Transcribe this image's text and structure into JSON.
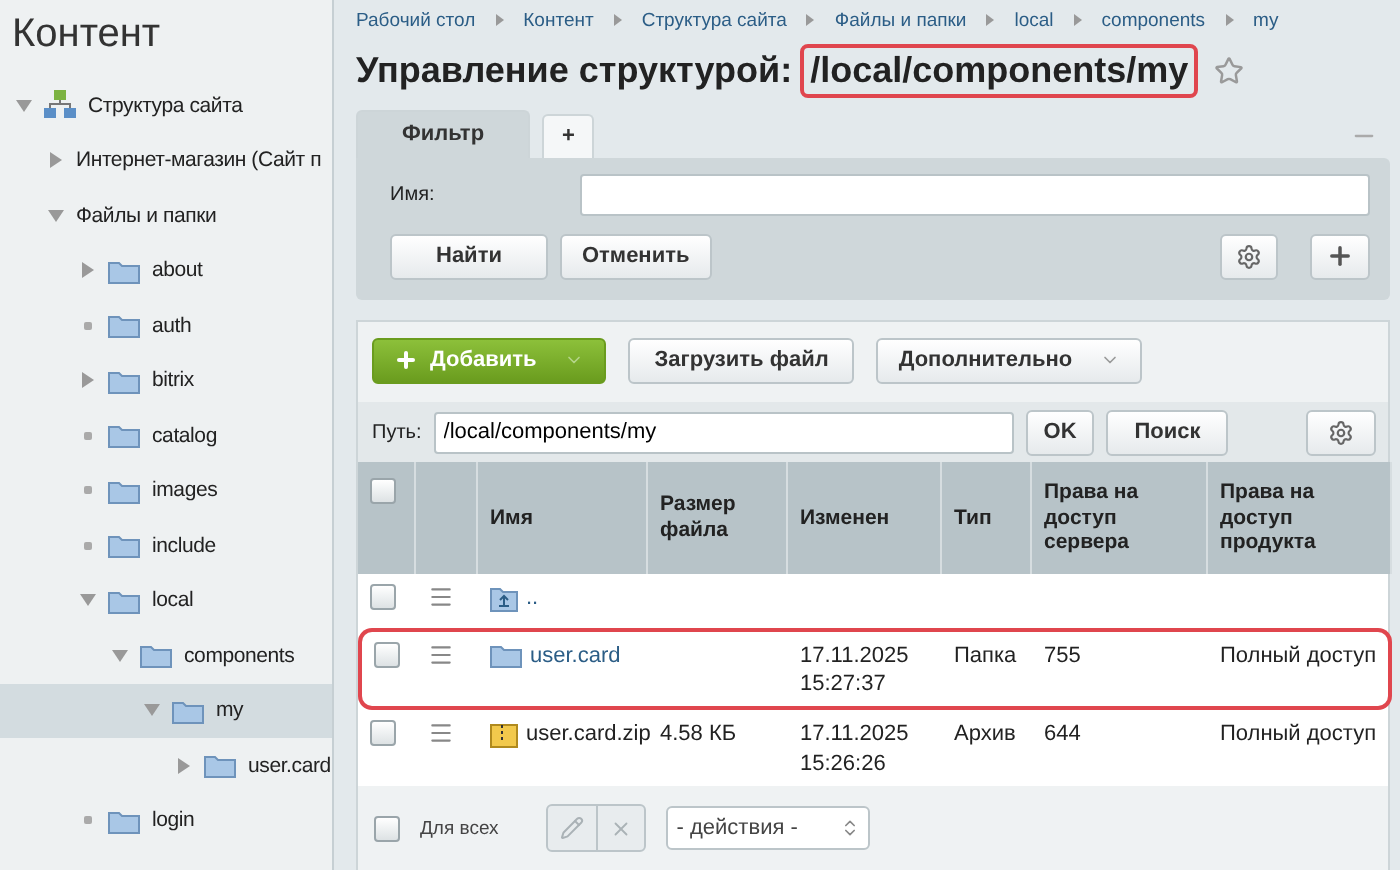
{
  "sidebar": {
    "title": "Контент",
    "tree": [
      {
        "label": "Структура сайта",
        "kind": "site",
        "expanded": true,
        "selected": false,
        "children": [
          {
            "label": "Интернет-магазин (Сайт п",
            "expanded": false,
            "selected": false
          },
          {
            "label": "Файлы и папки",
            "expanded": true,
            "selected": false,
            "children": [
              {
                "label": "about",
                "kind": "folder",
                "expanded": false,
                "selected": false
              },
              {
                "label": "auth",
                "kind": "folder",
                "leaf": true,
                "selected": false
              },
              {
                "label": "bitrix",
                "kind": "folder",
                "expanded": false,
                "selected": false
              },
              {
                "label": "catalog",
                "kind": "folder",
                "leaf": true,
                "selected": false
              },
              {
                "label": "images",
                "kind": "folder",
                "leaf": true,
                "selected": false
              },
              {
                "label": "include",
                "kind": "folder",
                "leaf": true,
                "selected": false
              },
              {
                "label": "local",
                "kind": "folder",
                "expanded": true,
                "selected": false,
                "children": [
                  {
                    "label": "components",
                    "kind": "folder",
                    "expanded": true,
                    "selected": false,
                    "children": [
                      {
                        "label": "my",
                        "kind": "folder",
                        "expanded": true,
                        "selected": true,
                        "children": [
                          {
                            "label": "user.card",
                            "kind": "folder",
                            "expanded": false,
                            "selected": false
                          }
                        ]
                      }
                    ]
                  }
                ]
              },
              {
                "label": "login",
                "kind": "folder",
                "leaf": true,
                "selected": false
              }
            ]
          }
        ]
      }
    ]
  },
  "breadcrumbs": [
    "Рабочий стол",
    "Контент",
    "Структура сайта",
    "Файлы и папки",
    "local",
    "components",
    "my"
  ],
  "title": {
    "prefix": "Управление структурой:",
    "path": "/local/components/my",
    "highlighted": true
  },
  "filter": {
    "tabs": [
      {
        "label": "Фильтр",
        "selected": true
      },
      {
        "label": "+",
        "selected": false
      }
    ],
    "fields": [
      {
        "label": "Имя:"
      }
    ],
    "buttons": [
      "Найти",
      "Отменить"
    ]
  },
  "toolbar": {
    "buttons": [
      {
        "label": "Добавить",
        "kind": "primary"
      },
      {
        "label": "Загрузить файл",
        "kind": "plain"
      },
      {
        "label": "Дополнительно",
        "kind": "dropdown"
      }
    ]
  },
  "path": {
    "label": "Путь:",
    "value": "/local/components/my",
    "buttons": [
      "OK",
      "Поиск"
    ]
  },
  "table": {
    "all_checked": false,
    "columns": [
      "Имя",
      "Размер файла",
      "Изменен",
      "Тип",
      "Права на доступ сервера",
      "Права на доступ продукта"
    ],
    "rows": [
      {
        "kind": "up",
        "name": "..",
        "checked": false,
        "highlighted": false
      },
      {
        "kind": "folder",
        "name": "user.card",
        "modified": "17.11.2025 15:27:37",
        "type": "Папка",
        "server": "755",
        "product": "Полный доступ",
        "checked": false,
        "highlighted": true
      },
      {
        "kind": "archive",
        "name": "user.card.zip",
        "size": "4.58 КБ",
        "modified": "17.11.2025 15:26:26",
        "type": "Архив",
        "server": "644",
        "product": "Полный доступ",
        "checked": false,
        "highlighted": false
      }
    ]
  },
  "footer": {
    "label": "Для всех",
    "checked": false,
    "action": "- действия -"
  }
}
